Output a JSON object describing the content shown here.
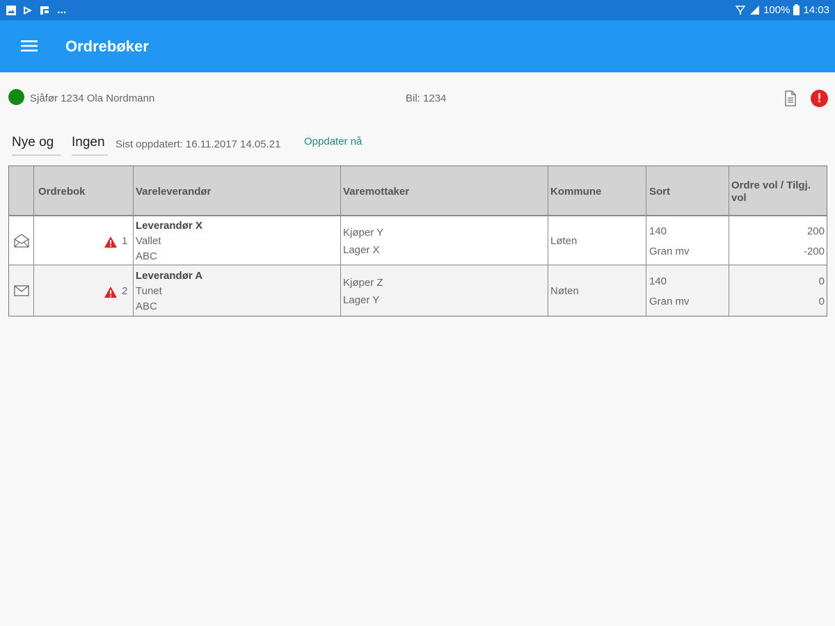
{
  "status_bar": {
    "left_icons": [
      "image-icon",
      "play-store-icon",
      "flag-icon"
    ],
    "overflow": "...",
    "battery": "100%",
    "time": "14:03"
  },
  "app_bar": {
    "menu_icon": "hamburger-menu-icon",
    "title": "Ordrebøker"
  },
  "info": {
    "driver": "Sjåfør 1234 Ola Nordmann",
    "driver_status_color": "#138a13",
    "car": "Bil: 1234"
  },
  "filters": {
    "filter_1": "Nye og",
    "filter_2": "Ingen",
    "last_updated": "Sist oppdatert: 16.11.2017 14.05.21",
    "update_now": "Oppdater nå"
  },
  "table": {
    "headers": [
      "Ordrebok",
      "Vareleverandør",
      "Varemottaker",
      "Kommune",
      "Sort",
      "Ordre vol / Tilgj. vol"
    ],
    "rows": [
      {
        "icon": "envelope-open-icon",
        "number": "1",
        "supplier": "Leverandør X",
        "supplier_line2": "Vallet",
        "supplier_line3": "ABC",
        "receiver": "Kjøper Y",
        "receiver_line2": "Lager X",
        "municipality": "Løten",
        "sort_code": "140",
        "sort_name": "Gran mv",
        "order_vol": "200",
        "available_vol": "-200"
      },
      {
        "icon": "envelope-closed-icon",
        "number": "2",
        "supplier": "Leverandør A",
        "supplier_line2": "Tunet",
        "supplier_line3": "ABC",
        "receiver": "Kjøper Z",
        "receiver_line2": "Lager Y",
        "municipality": "Nøten",
        "sort_code": "140",
        "sort_name": "Gran mv",
        "order_vol": "0",
        "available_vol": "0"
      }
    ]
  },
  "colors": {
    "status_bar": "#1976d2",
    "app_bar": "#2196f3",
    "alert": "#e02424",
    "warning": "#e02020",
    "link": "#1e8a7a"
  }
}
